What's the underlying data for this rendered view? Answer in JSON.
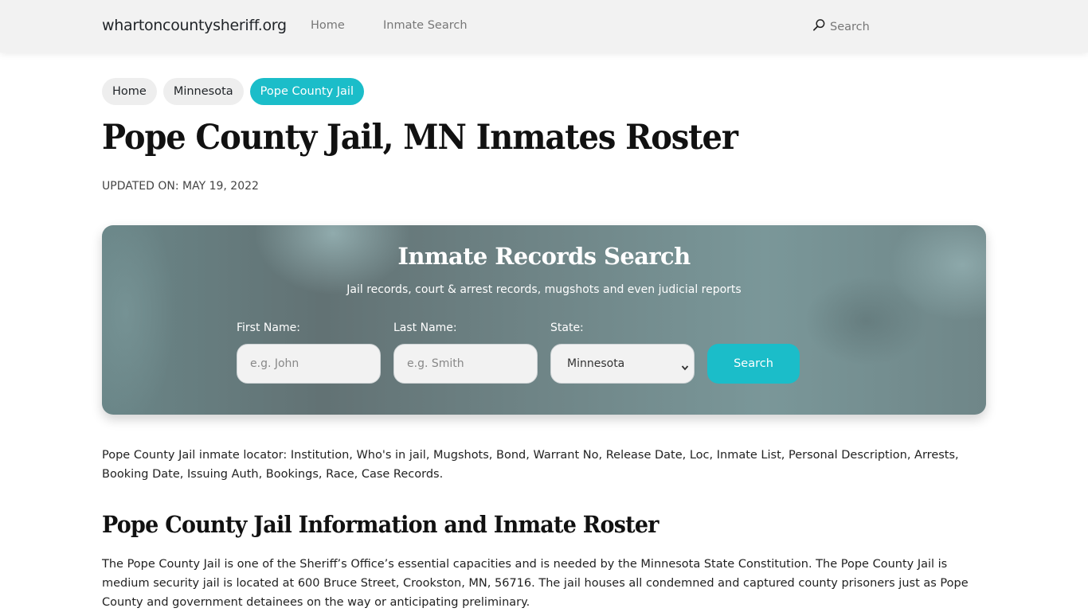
{
  "header": {
    "brand": "whartoncountysheriff.org",
    "nav": [
      {
        "label": "Home"
      },
      {
        "label": "Inmate Search"
      }
    ],
    "search": {
      "label": "Search",
      "icon": "search-icon"
    }
  },
  "breadcrumb": [
    {
      "label": "Home",
      "active": false
    },
    {
      "label": "Minnesota",
      "active": false
    },
    {
      "label": "Pope County Jail",
      "active": true
    }
  ],
  "page": {
    "title": "Pope County Jail, MN Inmates Roster",
    "updated": "UPDATED ON: MAY 19, 2022"
  },
  "search_card": {
    "title": "Inmate Records Search",
    "subtitle": "Jail records, court & arrest records, mugshots and even judicial reports",
    "first_name": {
      "label": "First Name:",
      "placeholder": "e.g. John",
      "value": ""
    },
    "last_name": {
      "label": "Last Name:",
      "placeholder": "e.g. Smith",
      "value": ""
    },
    "state": {
      "label": "State:",
      "selected": "Minnesota"
    },
    "button_label": "Search"
  },
  "content": {
    "intro": "Pope County Jail inmate locator: Institution, Who's in jail, Mugshots, Bond, Warrant No, Release Date, Loc, Inmate List, Personal Description, Arrests, Booking Date, Issuing Auth, Bookings, Race, Case Records.",
    "section_title": "Pope County Jail Information and Inmate Roster",
    "paragraph": "The Pope County Jail is one of the Sheriff’s Office’s essential capacities and is needed by the Minnesota State Constitution. The Pope County Jail is medium security jail is located at 600 Bruce Street, Crookston, MN, 56716. The jail houses all condemned and captured county prisoners just as Pope County and government detainees on the way or anticipating preliminary."
  },
  "colors": {
    "accent": "#1bbdc9",
    "navbar_bg": "#f2f2f2",
    "card_bg": "#6f8587"
  }
}
